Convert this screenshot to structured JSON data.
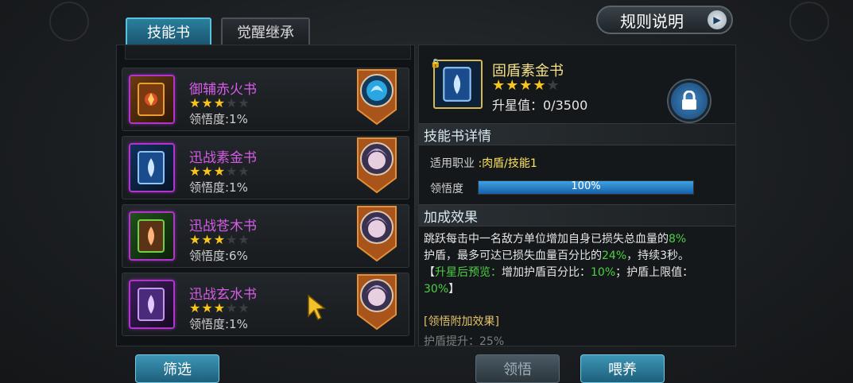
{
  "tabs": [
    {
      "label": "技能书",
      "active": true
    },
    {
      "label": "觉醒继承",
      "active": false
    }
  ],
  "rules_button": {
    "label": "规则说明",
    "icon": "play-arrow-icon"
  },
  "colors": {
    "accent": "#3d96b7",
    "item_name": "#d65ce8",
    "star": "#f7c51c",
    "green_value": "#4bd043",
    "title_gold": "#f5e08a"
  },
  "book_list": {
    "items": [
      {
        "name": "御辅赤火书",
        "stars": 3,
        "max_stars": 5,
        "comprehension": "领悟度:1%",
        "cover": "book-red-icon",
        "badge": "blue-creature-portrait"
      },
      {
        "name": "迅战素金书",
        "stars": 3,
        "max_stars": 5,
        "comprehension": "领悟度:1%",
        "cover": "book-blue-icon",
        "badge": "hero-portrait"
      },
      {
        "name": "迅战苍木书",
        "stars": 3,
        "max_stars": 5,
        "comprehension": "领悟度:6%",
        "cover": "book-green-icon",
        "badge": "hero-portrait"
      },
      {
        "name": "迅战玄水书",
        "stars": 3,
        "max_stars": 5,
        "comprehension": "领悟度:1%",
        "cover": "book-purple-icon",
        "badge": "hero-portrait"
      }
    ]
  },
  "filter_button": {
    "label": "筛选"
  },
  "detail": {
    "title": "固盾素金书",
    "stars": 4,
    "max_stars": 5,
    "upgrade_value": "升星值：0/3500",
    "locked": true
  },
  "details_section": {
    "heading": "技能书详情",
    "job_label": "适用职业",
    "job_value": ":肉盾/技能1",
    "comprehension_label": "领悟度",
    "comprehension_percent": 100,
    "comprehension_text": "100%"
  },
  "effect_section": {
    "heading": "加成效果",
    "parts": {
      "p1": "跳跃每击中一名敌方单位增加自身已损失总血量的",
      "v1": "8%",
      "p2": "护盾，最多可达已损失血量百分比的",
      "v2": "24%",
      "p3": "，持续3秒。",
      "p4": "【",
      "g1": "升星后预览：",
      "p5": "增加护盾百分比：",
      "v3": "10%",
      "p6": "；护盾上限值：",
      "v4": "30%",
      "p7": "】"
    },
    "extra_title": "[领悟附加效果]",
    "extra_peek": "护盾提升：25%"
  },
  "bottom_buttons": {
    "comprehend": "领悟",
    "feed": "喂养"
  }
}
